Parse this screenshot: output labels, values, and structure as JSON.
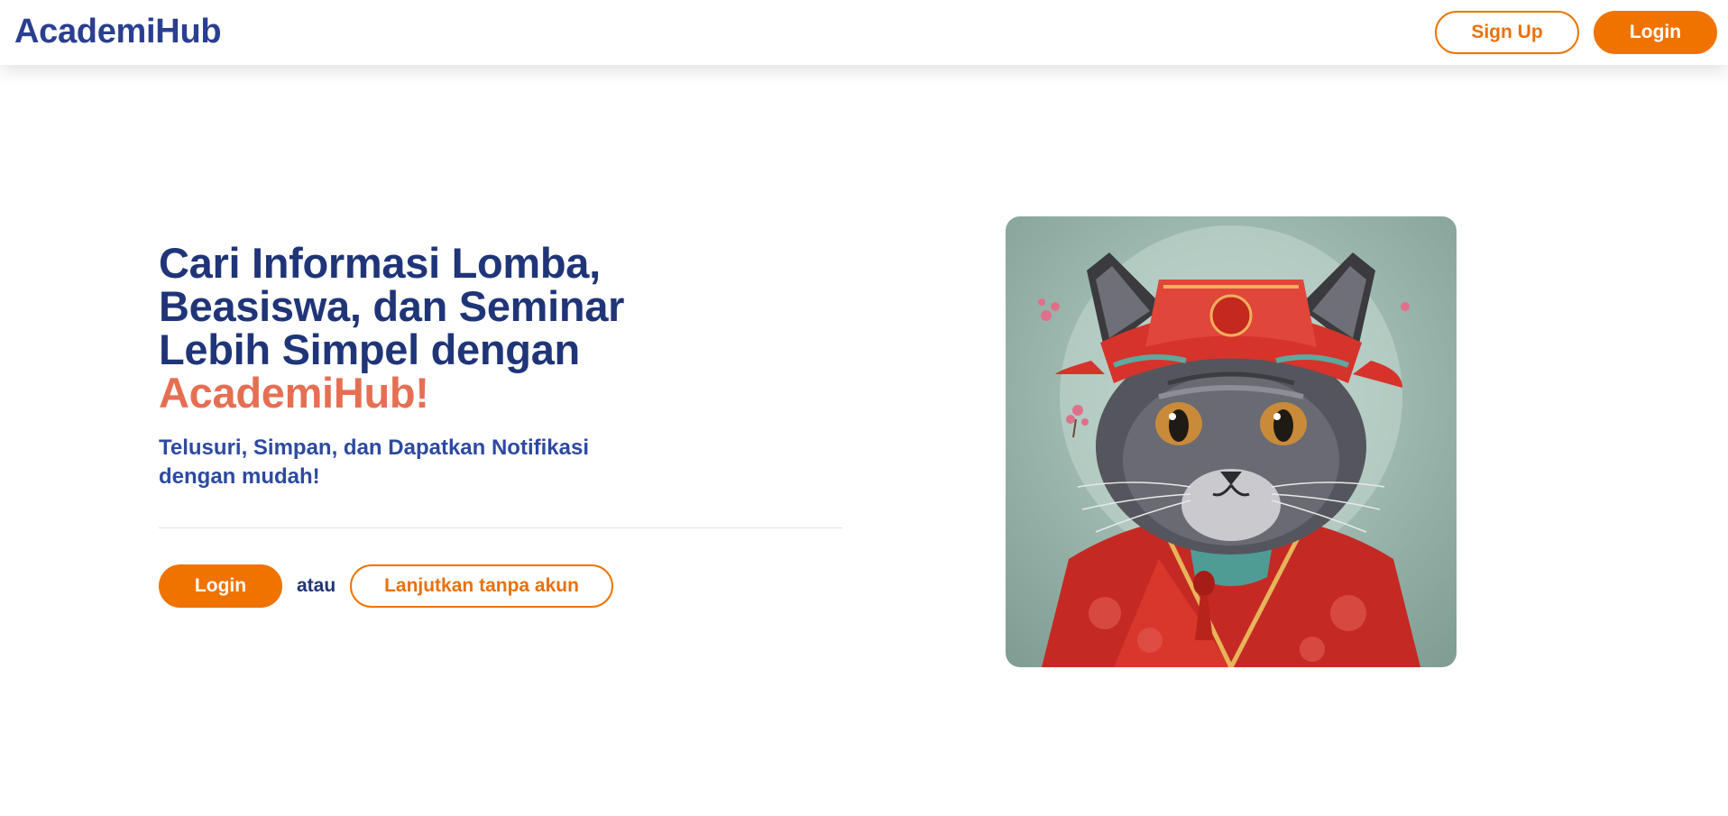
{
  "navbar": {
    "brand": "AcademiHub",
    "signup_label": "Sign Up",
    "login_label": "Login"
  },
  "hero": {
    "title_lines": [
      "Cari Informasi Lomba,",
      "Beasiswa, dan Seminar",
      "Lebih Simpel dengan"
    ],
    "title_accent": "AcademiHub!",
    "subtitle": "Telusuri, Simpan, dan Dapatkan Notifikasi dengan mudah!",
    "login_label": "Login",
    "or_label": "atau",
    "guest_label": "Lanjutkan tanpa akun",
    "image_alt": "cat-illustration"
  },
  "colors": {
    "brand_blue": "#2a3f8f",
    "title_blue": "#1f3578",
    "accent_orange": "#f07300",
    "accent_coral": "#e56f53"
  }
}
